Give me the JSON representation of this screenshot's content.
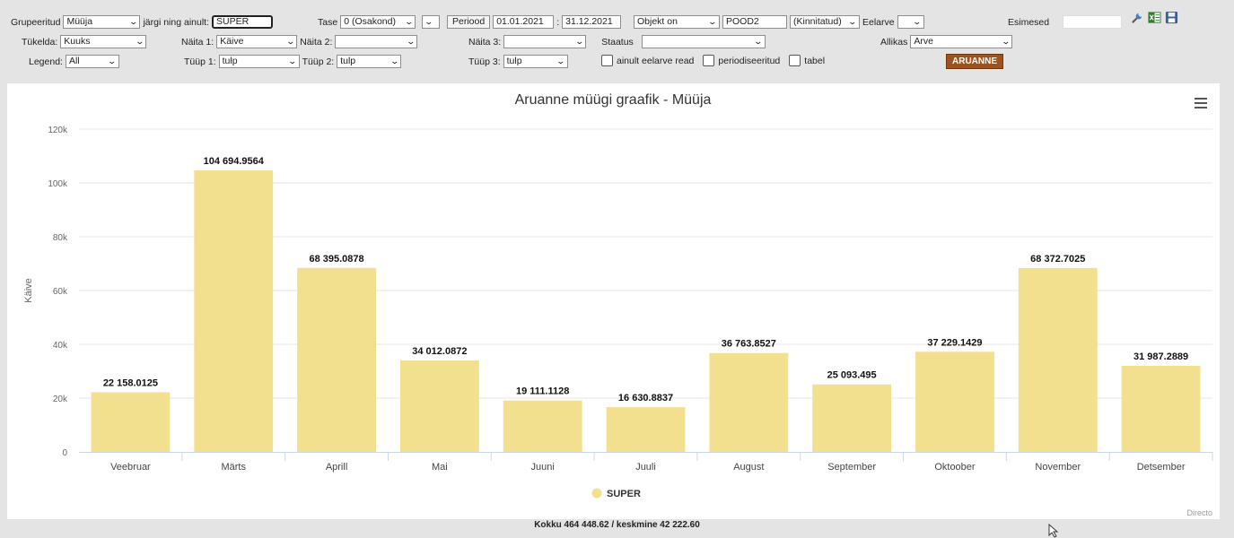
{
  "filters": {
    "grupeeritud": {
      "label": "Grupeeritud",
      "value": "Müüja"
    },
    "jargi_ainult": {
      "label": "järgi ning ainult:",
      "value": "SUPER"
    },
    "tase": {
      "label": "Tase",
      "value": "0 (Osakond)"
    },
    "periood": {
      "label": "Periood",
      "start": "01.01.2021",
      "separator": ":",
      "end": "31.12.2021"
    },
    "objekt": {
      "value": "Objekt on",
      "object_value": "POOD2"
    },
    "kinnitatud": {
      "value": "(Kinnitatud)"
    },
    "eelarve": {
      "label": "Eelarve",
      "value": ""
    },
    "esimesed": {
      "label": "Esimesed",
      "value": ""
    },
    "tukelda": {
      "label": "Tükelda:",
      "value": "Kuuks"
    },
    "naita1": {
      "label": "Näita 1:",
      "value": "Käive"
    },
    "naita2": {
      "label": "Näita 2:",
      "value": ""
    },
    "naita3": {
      "label": "Näita 3:",
      "value": ""
    },
    "staatus": {
      "label": "Staatus",
      "value": ""
    },
    "allikas": {
      "label": "Allikas",
      "value": "Arve"
    },
    "legend": {
      "label": "Legend:",
      "value": "All"
    },
    "tyyp1": {
      "label": "Tüüp 1:",
      "value": "tulp"
    },
    "tyyp2": {
      "label": "Tüüp 2:",
      "value": "tulp"
    },
    "tyyp3": {
      "label": "Tüüp 3:",
      "value": "tulp"
    },
    "checkboxes": {
      "budget_rows": "ainult eelarve read",
      "periodized": "periodiseeritud",
      "table": "tabel"
    },
    "run_button": "ARUANNE"
  },
  "icons": [
    "wrench-icon",
    "excel-icon",
    "save-icon"
  ],
  "chart_data": {
    "type": "bar",
    "title": "Aruanne müügi graafik - Müüja",
    "xlabel": "",
    "ylabel": "Käive",
    "categories": [
      "Veebruar",
      "Märts",
      "Aprill",
      "Mai",
      "Juuni",
      "Juuli",
      "August",
      "September",
      "Oktoober",
      "November",
      "Detsember"
    ],
    "series": [
      {
        "name": "SUPER",
        "color": "#f2e08f",
        "values": [
          22158.0125,
          104694.9564,
          68395.0878,
          34012.0872,
          19111.1128,
          16630.8837,
          36763.8527,
          25093.495,
          37229.1429,
          68372.7025,
          31987.2889
        ],
        "labels": [
          "22 158.0125",
          "104 694.9564",
          "68 395.0878",
          "34 012.0872",
          "19 111.1128",
          "16 630.8837",
          "36 763.8527",
          "25 093.495",
          "37 229.1429",
          "68 372.7025",
          "31 987.2889"
        ]
      }
    ],
    "ylim": [
      0,
      120000
    ],
    "yticks": [
      0,
      20000,
      40000,
      60000,
      80000,
      100000,
      120000
    ],
    "ytick_labels": [
      "0",
      "20k",
      "40k",
      "60k",
      "80k",
      "100k",
      "120k"
    ],
    "grid": true,
    "legend_position": "bottom-center",
    "credit": "Directo"
  },
  "footer": {
    "summary": "Kokku 464 448.62 / keskmine 42 222.60"
  }
}
